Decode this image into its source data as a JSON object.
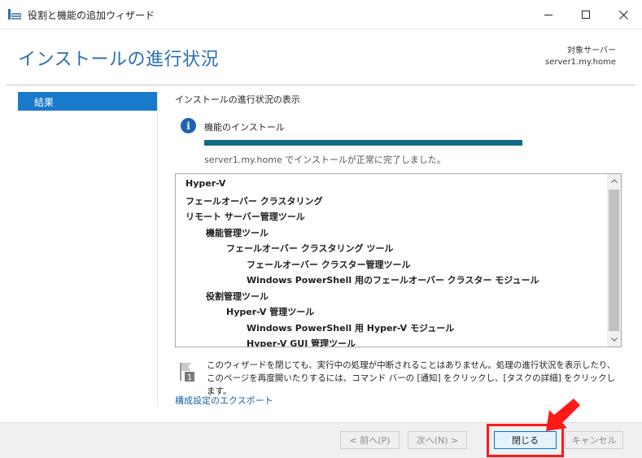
{
  "window": {
    "title": "役割と機能の追加ウィザード",
    "controls": {
      "minimize": "—",
      "maximize": "☐",
      "close": "✕"
    }
  },
  "header": {
    "title": "インストールの進行状況",
    "server_label": "対象サーバー",
    "server_name": "server1.my.home"
  },
  "nav": {
    "items": [
      {
        "label": "結果",
        "selected": true
      }
    ]
  },
  "main": {
    "section_heading": "インストールの進行状況の表示",
    "feature_label": "機能のインストール",
    "progress": 1.0,
    "status_text": "server1.my.home でインストールが正常に完了しました。",
    "results": [
      {
        "label": "Hyper-V",
        "level": 0
      },
      {
        "label": "フェールオーバー クラスタリング",
        "level": 0
      },
      {
        "label": "リモート サーバー管理ツール",
        "level": 0
      },
      {
        "label": "機能管理ツール",
        "level": 1
      },
      {
        "label": "フェールオーバー クラスタリング ツール",
        "level": 2
      },
      {
        "label": "フェールオーバー クラスター管理ツール",
        "level": 3
      },
      {
        "label": "Windows PowerShell 用のフェールオーバー クラスター モジュール",
        "level": 3
      },
      {
        "label": "役割管理ツール",
        "level": 1
      },
      {
        "label": "Hyper-V 管理ツール",
        "level": 2
      },
      {
        "label": "Windows PowerShell 用 Hyper-V モジュール",
        "level": 3
      },
      {
        "label": "Hyper-V GUI 管理ツール",
        "level": 3
      }
    ],
    "note_text": "このウィザードを閉じても、実行中の処理が中断されることはありません。処理の進行状況を表示したり、このページを再度開いたりするには、コマンド バーの [通知] をクリックし、[タスクの詳細] をクリックします。",
    "note_badge": "1",
    "export_link": "構成設定のエクスポート"
  },
  "footer": {
    "prev_label": "< 前へ(P)",
    "next_label": "次へ(N) >",
    "close_label": "閉じる",
    "cancel_label": "キャンセル"
  },
  "colors": {
    "title_blue": "#2a6fb0",
    "nav_selected": "#1979ca",
    "progress": "#136a85",
    "highlight_red": "#ff1a1a"
  }
}
